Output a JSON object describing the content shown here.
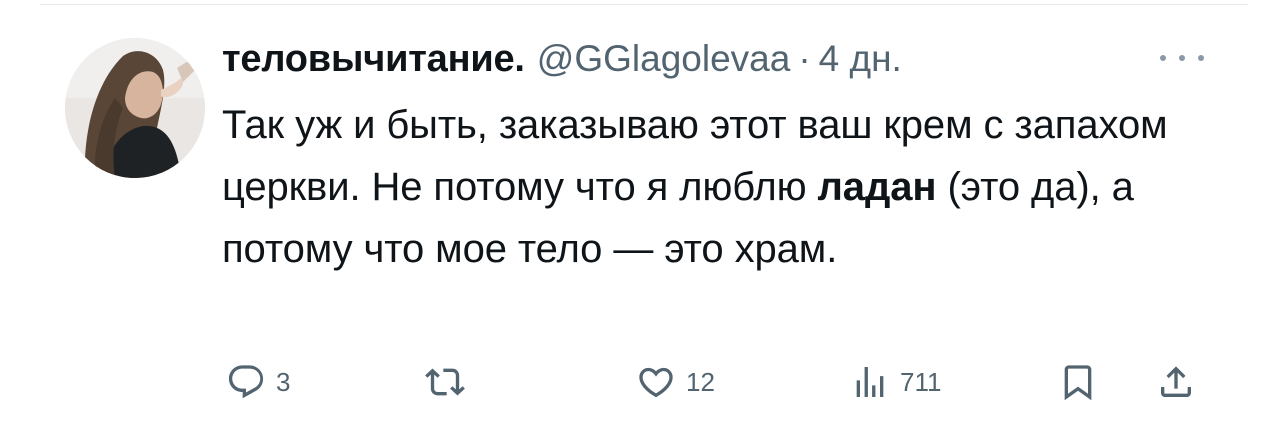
{
  "tweet": {
    "display_name": "теловычитание.",
    "handle": "@GGlagolevaa",
    "separator": "·",
    "time": "4 дн.",
    "text_part1": "Так уж и быть, заказываю этот ваш крем с запахом церкви. Не потому что я люблю ",
    "text_bold": "ладан",
    "text_part2": " (это да), а потому что мое тело — это храм."
  },
  "actions": {
    "reply_count": "3",
    "retweet_count": "",
    "like_count": "12",
    "views_count": "711"
  },
  "icons": {
    "reply": "reply-icon",
    "retweet": "retweet-icon",
    "like": "heart-icon",
    "views": "views-icon",
    "bookmark": "bookmark-icon",
    "share": "share-icon",
    "more": "more-icon"
  },
  "colors": {
    "text": "#0f1419",
    "secondary": "#536471"
  }
}
